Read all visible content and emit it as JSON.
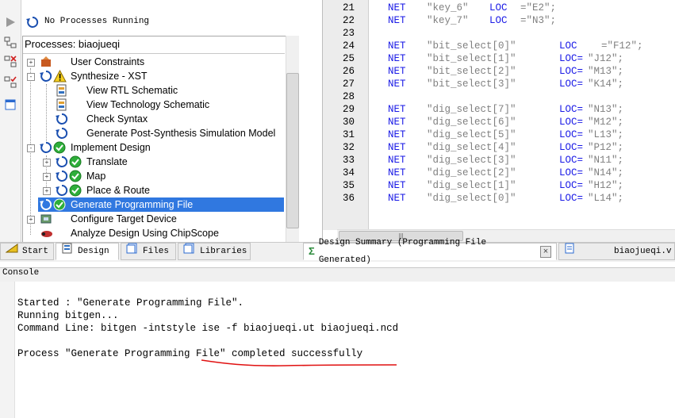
{
  "processes": {
    "status": "No Processes Running",
    "title": "Processes: biaojueqi",
    "items": [
      {
        "label": "User Constraints"
      },
      {
        "label": "Synthesize - XST"
      },
      {
        "label": "View RTL Schematic"
      },
      {
        "label": "View Technology Schematic"
      },
      {
        "label": "Check Syntax"
      },
      {
        "label": "Generate Post-Synthesis Simulation Model"
      },
      {
        "label": "Implement Design"
      },
      {
        "label": "Translate"
      },
      {
        "label": "Map"
      },
      {
        "label": "Place & Route"
      },
      {
        "label": "Generate Programming File"
      },
      {
        "label": "Configure Target Device"
      },
      {
        "label": "Analyze Design Using ChipScope"
      }
    ]
  },
  "editor": {
    "lines": [
      {
        "num": "21",
        "kw": "NET",
        "sig": "\"key_6\"",
        "loc": "LOC",
        "val": "=\"E2\";"
      },
      {
        "num": "22",
        "kw": "NET",
        "sig": "\"key_7\"",
        "loc": "LOC",
        "val": "=\"N3\";"
      },
      {
        "num": "23",
        "kw": "",
        "sig": "",
        "loc": "",
        "val": ""
      },
      {
        "num": "24",
        "kw": "NET",
        "sig": "\"bit_select[0]\"",
        "loc": "LOC",
        "val": "=\"F12\";"
      },
      {
        "num": "25",
        "kw": "NET",
        "sig": "\"bit_select[1]\"",
        "loc": "LOC=",
        "val": "\"J12\";"
      },
      {
        "num": "26",
        "kw": "NET",
        "sig": "\"bit_select[2]\"",
        "loc": "LOC=",
        "val": "\"M13\";"
      },
      {
        "num": "27",
        "kw": "NET",
        "sig": "\"bit_select[3]\"",
        "loc": "LOC=",
        "val": "\"K14\";"
      },
      {
        "num": "28",
        "kw": "",
        "sig": "",
        "loc": "",
        "val": ""
      },
      {
        "num": "29",
        "kw": "NET",
        "sig": "\"dig_select[7]\"",
        "loc": "LOC=",
        "val": "\"N13\";"
      },
      {
        "num": "30",
        "kw": "NET",
        "sig": "\"dig_select[6]\"",
        "loc": "LOC=",
        "val": "\"M12\";"
      },
      {
        "num": "31",
        "kw": "NET",
        "sig": "\"dig_select[5]\"",
        "loc": "LOC=",
        "val": "\"L13\";"
      },
      {
        "num": "32",
        "kw": "NET",
        "sig": "\"dig_select[4]\"",
        "loc": "LOC=",
        "val": "\"P12\";"
      },
      {
        "num": "33",
        "kw": "NET",
        "sig": "\"dig_select[3]\"",
        "loc": "LOC=",
        "val": "\"N11\";"
      },
      {
        "num": "34",
        "kw": "NET",
        "sig": "\"dig_select[2]\"",
        "loc": "LOC=",
        "val": "\"N14\";"
      },
      {
        "num": "35",
        "kw": "NET",
        "sig": "\"dig_select[1]\"",
        "loc": "LOC=",
        "val": "\"H12\";"
      },
      {
        "num": "36",
        "kw": "NET",
        "sig": "\"dig_select[0]\"",
        "loc": "LOC=",
        "val": "\"L14\";"
      }
    ]
  },
  "tabs_left": [
    {
      "label": "Start",
      "icon": "start-icon"
    },
    {
      "label": "Design",
      "icon": "design-icon"
    },
    {
      "label": "Files",
      "icon": "files-icon"
    },
    {
      "label": "Libraries",
      "icon": "libraries-icon"
    }
  ],
  "tabs_right": [
    {
      "label": "Design Summary (Programming File Generated)",
      "icon": "sigma-icon"
    },
    {
      "label": "biaojueqi.v",
      "icon": "document-icon"
    }
  ],
  "console": {
    "label": "Console",
    "lines": [
      "Started : \"Generate Programming File\".",
      "Running bitgen...",
      "Command Line: bitgen -intstyle ise -f biaojueqi.ut biaojueqi.ncd",
      "",
      "Process \"Generate Programming File\" completed successfully"
    ]
  },
  "colors": {
    "selection": "#3078e0",
    "keyword": "#1a1ae6",
    "string": "#808080",
    "annotation": "#e01010"
  }
}
